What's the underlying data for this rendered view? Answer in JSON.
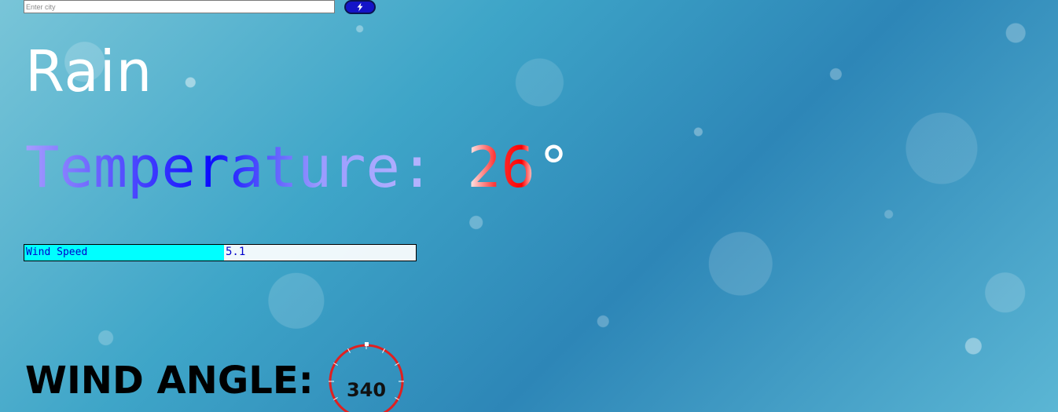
{
  "search": {
    "placeholder": "Enter city",
    "button_icon": "lightning-icon"
  },
  "weather": {
    "condition": "Rain",
    "temperature_label": "Temperature:",
    "temperature_value": "26",
    "temperature_unit": "°"
  },
  "wind": {
    "speed_label": "Wind Speed",
    "speed_value": "5.1",
    "speed_fill_percent": 51,
    "angle_label": "WIND ANGLE:",
    "angle_value": "340"
  },
  "colors": {
    "button": "#1414c8",
    "wind_fill": "#00ffff",
    "compass_ring": "#e02020"
  }
}
